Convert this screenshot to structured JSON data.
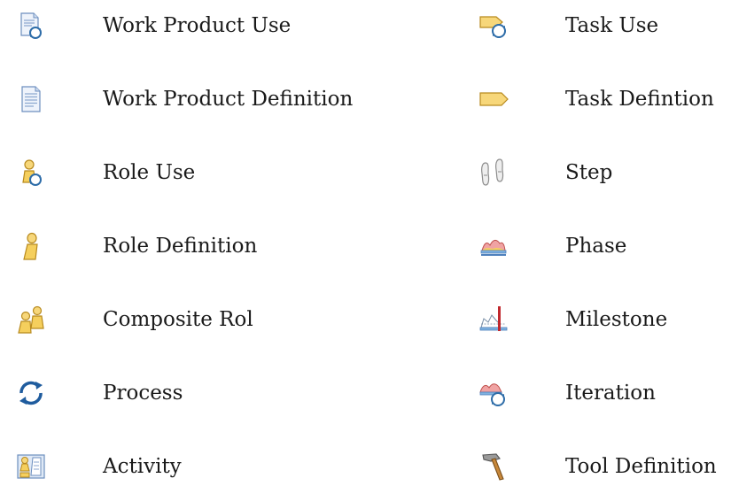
{
  "legend": {
    "left": [
      {
        "label": "Work Product Use",
        "icon": "work-product-use-icon"
      },
      {
        "label": "Work Product Definition",
        "icon": "work-product-definition-icon"
      },
      {
        "label": "Role Use",
        "icon": "role-use-icon"
      },
      {
        "label": "Role Definition",
        "icon": "role-definition-icon"
      },
      {
        "label": "Composite Rol",
        "icon": "composite-role-icon"
      },
      {
        "label": "Process",
        "icon": "process-icon"
      },
      {
        "label": "Activity",
        "icon": "activity-icon"
      }
    ],
    "right": [
      {
        "label": "Task Use",
        "icon": "task-use-icon"
      },
      {
        "label": "Task Defintion",
        "icon": "task-definition-icon"
      },
      {
        "label": "Step",
        "icon": "step-icon"
      },
      {
        "label": "Phase",
        "icon": "phase-icon"
      },
      {
        "label": "Milestone",
        "icon": "milestone-icon"
      },
      {
        "label": "Iteration",
        "icon": "iteration-icon"
      },
      {
        "label": "Tool Definition",
        "icon": "tool-definition-icon"
      }
    ]
  }
}
